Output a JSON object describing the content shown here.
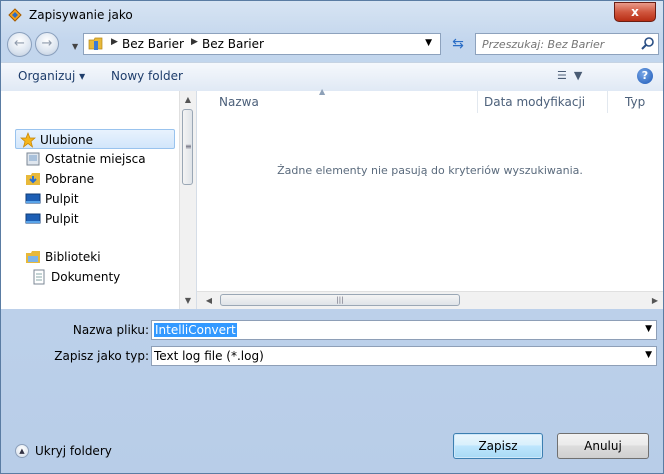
{
  "window": {
    "title": "Zapisywanie jako",
    "close_label": "x"
  },
  "address_bar": {
    "crumbs": [
      "Bez Barier",
      "Bez Barier"
    ]
  },
  "search": {
    "placeholder": "Przeszukaj: Bez Barier"
  },
  "toolbar": {
    "organize_label": "Organizuj ▾",
    "new_folder_label": "Nowy folder"
  },
  "nav_pane": {
    "items": [
      {
        "label": "Ulubione",
        "icon": "star-icon"
      },
      {
        "label": "Ostatnie miejsca",
        "icon": "recent-places-icon"
      },
      {
        "label": "Pobrane",
        "icon": "downloads-icon"
      },
      {
        "label": "Pulpit",
        "icon": "desktop-icon"
      },
      {
        "label": "Pulpit",
        "icon": "desktop-icon"
      },
      {
        "label": "Biblioteki",
        "icon": "libraries-icon"
      },
      {
        "label": "Dokumenty",
        "icon": "documents-icon"
      }
    ]
  },
  "file_pane": {
    "columns": {
      "name": "Nazwa",
      "date": "Data modyfikacji",
      "type": "Typ"
    },
    "empty_message": "Żadne elementy nie pasują do kryteriów wyszukiwania."
  },
  "form": {
    "filename_label": "Nazwa pliku:",
    "filename_value": "IntelliConvert",
    "filetype_label": "Zapisz jako typ:",
    "filetype_value": "Text log file (*.log)"
  },
  "footer": {
    "hide_folders_label": "Ukryj foldery",
    "save_label": "Zapisz",
    "cancel_label": "Anuluj"
  }
}
